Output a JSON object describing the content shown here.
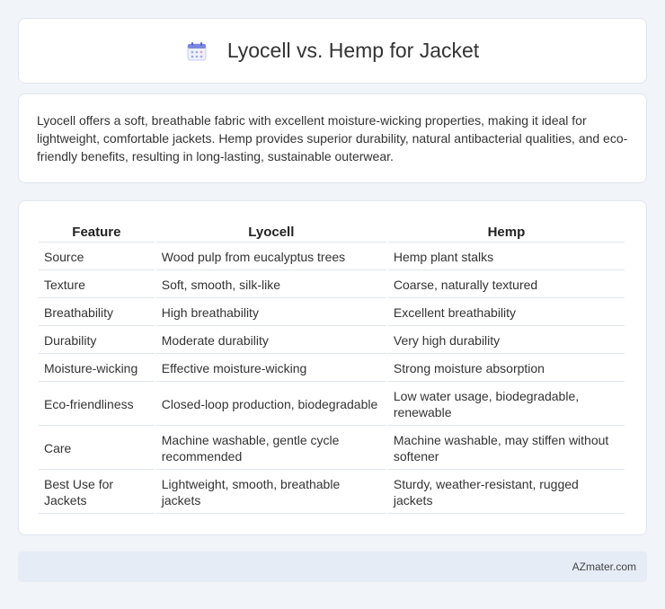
{
  "header": {
    "title": "Lyocell vs. Hemp for Jacket",
    "icon": "calendar-icon"
  },
  "intro": {
    "text": "Lyocell offers a soft, breathable fabric with excellent moisture-wicking properties, making it ideal for lightweight, comfortable jackets. Hemp provides superior durability, natural antibacterial qualities, and eco-friendly benefits, resulting in long-lasting, sustainable outerwear."
  },
  "table": {
    "headers": [
      "Feature",
      "Lyocell",
      "Hemp"
    ],
    "rows": [
      [
        "Source",
        "Wood pulp from eucalyptus trees",
        "Hemp plant stalks"
      ],
      [
        "Texture",
        "Soft, smooth, silk-like",
        "Coarse, naturally textured"
      ],
      [
        "Breathability",
        "High breathability",
        "Excellent breathability"
      ],
      [
        "Durability",
        "Moderate durability",
        "Very high durability"
      ],
      [
        "Moisture-wicking",
        "Effective moisture-wicking",
        "Strong moisture absorption"
      ],
      [
        "Eco-friendliness",
        "Closed-loop production, biodegradable",
        "Low water usage, biodegradable, renewable"
      ],
      [
        "Care",
        "Machine washable, gentle cycle recommended",
        "Machine washable, may stiffen without softener"
      ],
      [
        "Best Use for Jackets",
        "Lightweight, smooth, breathable jackets",
        "Sturdy, weather-resistant, rugged jackets"
      ]
    ]
  },
  "footer": {
    "brand": "AZmater.com"
  }
}
